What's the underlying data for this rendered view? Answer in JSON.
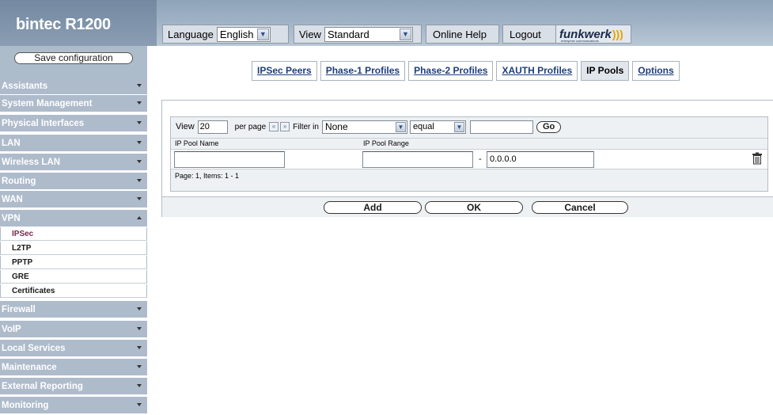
{
  "header": {
    "product": "bintec R1200",
    "language_label": "Language",
    "language_value": "English",
    "view_label": "View",
    "view_value": "Standard",
    "online_help": "Online Help",
    "logout": "Logout",
    "logo_word": "funkwerk",
    "logo_tagline": "enterprise communications"
  },
  "sidebar": {
    "save_label": "Save configuration",
    "items": [
      {
        "label": "Assistants"
      },
      {
        "label": "System Management"
      },
      {
        "label": "Physical Interfaces"
      },
      {
        "label": "LAN"
      },
      {
        "label": "Wireless LAN"
      },
      {
        "label": "Routing"
      },
      {
        "label": "WAN"
      },
      {
        "label": "VPN"
      },
      {
        "label": "Firewall"
      },
      {
        "label": "VoIP"
      },
      {
        "label": "Local Services"
      },
      {
        "label": "Maintenance"
      },
      {
        "label": "External Reporting"
      },
      {
        "label": "Monitoring"
      }
    ],
    "vpn_sub": [
      "IPSec",
      "L2TP",
      "PPTP",
      "GRE",
      "Certificates"
    ]
  },
  "tabs": [
    "IPSec Peers",
    "Phase-1 Profiles",
    "Phase-2 Profiles",
    "XAUTH Profiles",
    "IP Pools",
    "Options"
  ],
  "active_tab": "IP Pools",
  "filter": {
    "view_label": "View",
    "view_value": "20",
    "per_page": "per page",
    "prev": "«",
    "next": "»",
    "filter_in": "Filter in",
    "field_value": "None",
    "op_value": "equal",
    "search_value": "",
    "go": "Go"
  },
  "table": {
    "columns": [
      "IP Pool Name",
      "IP Pool Range"
    ],
    "rows": [
      {
        "name": "",
        "range_start": "",
        "range_sep": "-",
        "range_end": "0.0.0.0"
      }
    ],
    "page_info": "Page: 1, Items: 1 - 1"
  },
  "buttons": {
    "add": "Add",
    "ok": "OK",
    "cancel": "Cancel"
  }
}
